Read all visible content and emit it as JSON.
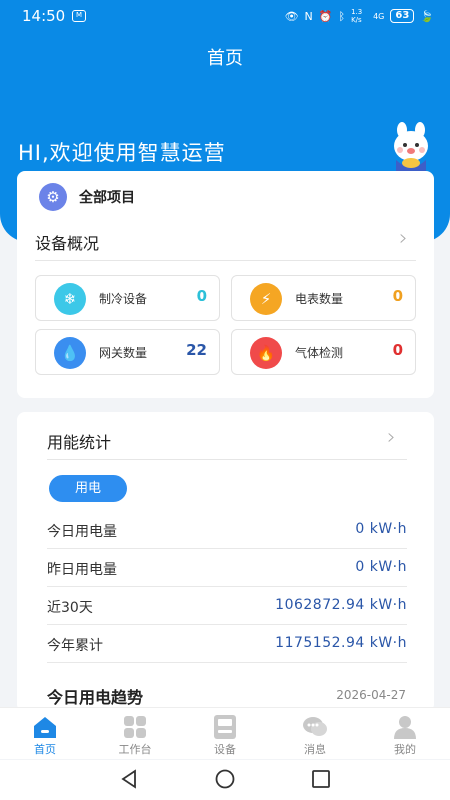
{
  "status_bar": {
    "time": "14:50",
    "msg_badge": "M",
    "network": "1.3\nK/s",
    "signal": "4G",
    "battery": "63"
  },
  "header": {
    "title": "首页",
    "greeting": "HI,欢迎使用智慧运营"
  },
  "project": {
    "label": "全部项目"
  },
  "device_overview": {
    "title": "设备概况",
    "tiles": [
      {
        "label": "制冷设备",
        "value": "0",
        "icon": "snowflake-icon",
        "color": "#3cc8e8",
        "value_color": "#2cc0d8"
      },
      {
        "label": "电表数量",
        "value": "0",
        "icon": "lightning-icon",
        "color": "#f5a623",
        "value_color": "#f0a020"
      },
      {
        "label": "网关数量",
        "value": "22",
        "icon": "droplet-icon",
        "color": "#3a8ef0",
        "value_color": "#2a56a8"
      },
      {
        "label": "气体检测",
        "value": "0",
        "icon": "flame-icon",
        "color": "#f04a4a",
        "value_color": "#e03030"
      }
    ]
  },
  "energy": {
    "title": "用能统计",
    "tab": "用电",
    "rows": [
      {
        "label": "今日用电量",
        "value": "0 kW·h"
      },
      {
        "label": "昨日用电量",
        "value": "0 kW·h"
      },
      {
        "label": "近30天",
        "value": "1062872.94 kW·h"
      },
      {
        "label": "今年累计",
        "value": "1175152.94 kW·h"
      }
    ],
    "trend_title": "今日用电趋势",
    "trend_date": "2026-04-27"
  },
  "tabbar": [
    {
      "label": "首页",
      "icon": "home-icon",
      "active": true
    },
    {
      "label": "工作台",
      "icon": "grid-icon",
      "active": false
    },
    {
      "label": "设备",
      "icon": "device-icon",
      "active": false
    },
    {
      "label": "消息",
      "icon": "chat-icon",
      "active": false
    },
    {
      "label": "我的",
      "icon": "user-icon",
      "active": false
    }
  ],
  "colors": {
    "primary": "#0a8ae6",
    "accent": "#2e8ef0",
    "value_blue": "#2a56a8"
  }
}
